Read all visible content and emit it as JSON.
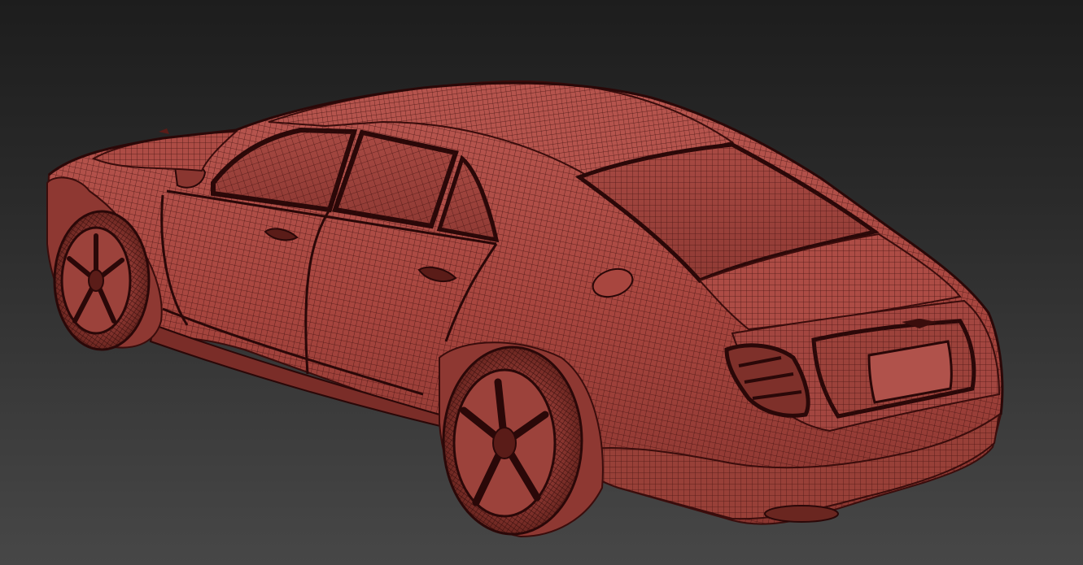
{
  "viewport": {
    "background_top": "#1d1d1d",
    "background_bottom": "#474747"
  },
  "model": {
    "subject": "car-wireframe",
    "shading": "wireframe-on-shaded",
    "surface_color": "#a8463f",
    "wire_color": "#3a0d0c",
    "highlight_color": "#c86a62",
    "shadow_color": "#5a1c18"
  }
}
